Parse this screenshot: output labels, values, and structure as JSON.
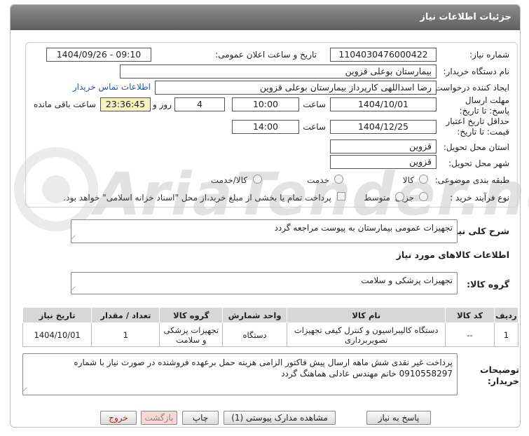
{
  "header": {
    "title": "جزئیات اطلاعات نیاز"
  },
  "fields": {
    "need_number_label": "شماره نیاز:",
    "need_number_value": "1104030476000422",
    "announce_label": "تاریخ و ساعت اعلان عمومی:",
    "announce_value": "1404/09/26 - 09:10",
    "buyer_org_label": "نام دستگاه خریدار:",
    "buyer_org_value": "بیمارستان بوعلی قزوین",
    "requester_label": "ایجاد کننده درخواست:",
    "requester_value": "رضا اسداللهی کارپرداز بیمارستان بوعلی قزوین",
    "contact_link": "اطلاعات تماس خریدار",
    "reply_deadline_label": "مهلت ارسال پاسخ: تا تاریخ:",
    "reply_date": "1404/10/01",
    "time_label": "ساعت",
    "reply_time": "10:00",
    "days_value": "4",
    "days_label": "روز و",
    "remaining_time": "23:36:45",
    "remaining_label": "ساعت باقی مانده",
    "price_validity_label": "حداقل تاریخ اعتبار قیمت: تا تاریخ:",
    "price_validity_date": "1404/12/25",
    "price_validity_time": "14:00",
    "province_label": "استان محل تحویل:",
    "province_value": "قزوین",
    "city_label": "شهر محل تحویل:",
    "city_value": "قزوین",
    "category_label": "طبقه بندی موضوعی:",
    "category_options": [
      "کالا",
      "خدمت",
      "کالا/خدمت"
    ],
    "process_label": "نوع فرآیند خرید :",
    "process_options": [
      "جزیی",
      "متوسط"
    ],
    "process_note": "پرداخت تمام یا بخشی از مبلغ خرید،از محل \"اسناد خزانه اسلامی\" خواهد بود."
  },
  "description": {
    "label": "شرح کلی نیاز:",
    "value": "تجهیزات عمومی بیمارستان  به پیوست مراجعه گردد"
  },
  "goods_section": {
    "title": "اطلاعات کالاهای مورد نیاز",
    "group_label": "گروه کالا:",
    "group_value": "تجهیزات پزشکی و سلامت"
  },
  "table": {
    "columns": [
      "ردیف",
      "کد کالا",
      "نام کالا",
      "واحد شمارش",
      "گروه کالا",
      "تعداد / مقدار",
      "تاریخ نیاز"
    ],
    "rows": [
      {
        "index": "1",
        "code": "--",
        "name": "دستگاه کالیبراسیون و کنترل کیفی تجهیزات تصویربرداری",
        "unit": "دستگاه",
        "group": "تجهیزات پزشکی و سلامت",
        "qty": "1",
        "date": "1404/10/01"
      }
    ]
  },
  "buyer_notes": {
    "label": "توضیحات خریدار:",
    "value": "پرداخت غیر نقدی شش ماهه ارسال پیش فاکتور الزامی هزینه حمل برعهده فروشنده در صورت نیاز با شماره 0910558297 خانم مهندس عادلی هماهنگ گردد"
  },
  "buttons": {
    "reply": "پاسخ به نیاز",
    "attachments": "مشاهده مدارک پیوستی (1)",
    "print": "چاپ",
    "back": "بازگشت",
    "exit": "خروج"
  },
  "watermark": {
    "text": "AriaTender.net"
  }
}
